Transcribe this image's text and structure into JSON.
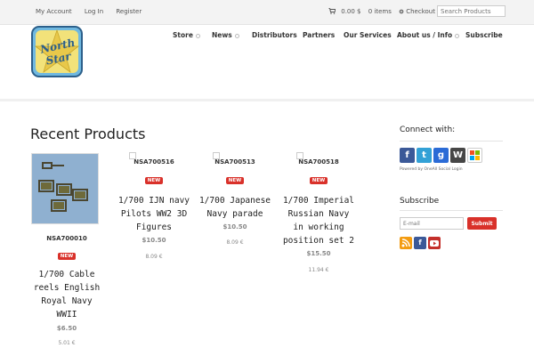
{
  "topbar": {
    "links": [
      "My Account",
      "Log In",
      "Register"
    ],
    "cart_amount": "0.00 $",
    "cart_items": "0 items",
    "checkout": "Checkout",
    "search_placeholder": "Search Products"
  },
  "logo": {
    "line1": "North",
    "line2": "Star"
  },
  "nav": [
    {
      "label": "Store",
      "dropdown": true
    },
    {
      "label": "News",
      "dropdown": true
    },
    {
      "label": "Distributors",
      "dropdown": false
    },
    {
      "label": "Partners",
      "dropdown": false
    },
    {
      "label": "Our Services",
      "dropdown": false
    },
    {
      "label": "About us / Info",
      "dropdown": true
    },
    {
      "label": "Subscribe",
      "dropdown": false
    }
  ],
  "main": {
    "title": "Recent Products",
    "products": [
      {
        "sku": "NSA700010",
        "badge": "NEW",
        "name_lines": [
          "1/700 Cable",
          "reels English",
          "Royal Navy",
          "WWII"
        ],
        "price": "$6.50",
        "eur": "5.01 €"
      },
      {
        "sku": "NSA700516",
        "badge": "NEW",
        "name_lines": [
          "1/700 IJN navy",
          "Pilots WW2 3D",
          "Figures"
        ],
        "price": "$10.50",
        "eur": "8.09 €"
      },
      {
        "sku": "NSA700513",
        "badge": "NEW",
        "name_lines": [
          "1/700 Japanese",
          "Navy parade"
        ],
        "price": "$10.50",
        "eur": "8.09 €"
      },
      {
        "sku": "NSA700518",
        "badge": "NEW",
        "name_lines": [
          "1/700 Imperial",
          "Russian Navy",
          "in working",
          "position set 2"
        ],
        "price": "$15.50",
        "eur": "11.94 €"
      }
    ]
  },
  "sidebar": {
    "connect_title": "Connect with:",
    "powered": "Powered by OneAll Social Login",
    "subscribe_title": "Subscribe",
    "email_placeholder": "E-mail",
    "submit_label": "Submit"
  },
  "colors": {
    "accent": "#d9312a",
    "facebook": "#3b5998",
    "twitter": "#33a1d6",
    "google": "#2b6bd6",
    "wordpress": "#464646",
    "rss": "#f39c12",
    "youtube": "#c4302b"
  }
}
